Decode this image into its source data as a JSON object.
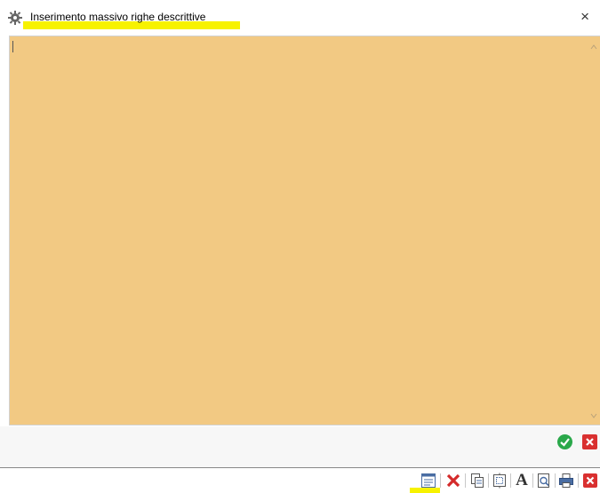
{
  "window": {
    "title": "Inserimento massivo righe descrittive",
    "title_icon": "gear-icon",
    "close_label": "×"
  },
  "editor": {
    "value": "",
    "background_color": "#f2c983"
  },
  "footer_buttons": [
    {
      "name": "confirm-button",
      "icon": "check-circle-icon",
      "color": "#2aa84a"
    },
    {
      "name": "cancel-button",
      "icon": "close-box-icon",
      "color": "#d93030"
    }
  ],
  "toolbar": {
    "buttons": [
      {
        "name": "insert-rows-button",
        "icon": "table-insert-icon"
      },
      {
        "name": "delete-button",
        "icon": "red-x-icon"
      },
      {
        "name": "copy-button",
        "icon": "copy-page-icon"
      },
      {
        "name": "fit-page-button",
        "icon": "page-frame-icon"
      },
      {
        "name": "font-button",
        "icon": "font-a-icon",
        "label": "A"
      },
      {
        "name": "print-preview-button",
        "icon": "magnifier-page-icon"
      },
      {
        "name": "print-button",
        "icon": "printer-icon"
      },
      {
        "name": "close-toolbar-button",
        "icon": "close-box-icon"
      }
    ]
  },
  "colors": {
    "highlight": "#f7f200",
    "editor_bg": "#f2c983"
  }
}
